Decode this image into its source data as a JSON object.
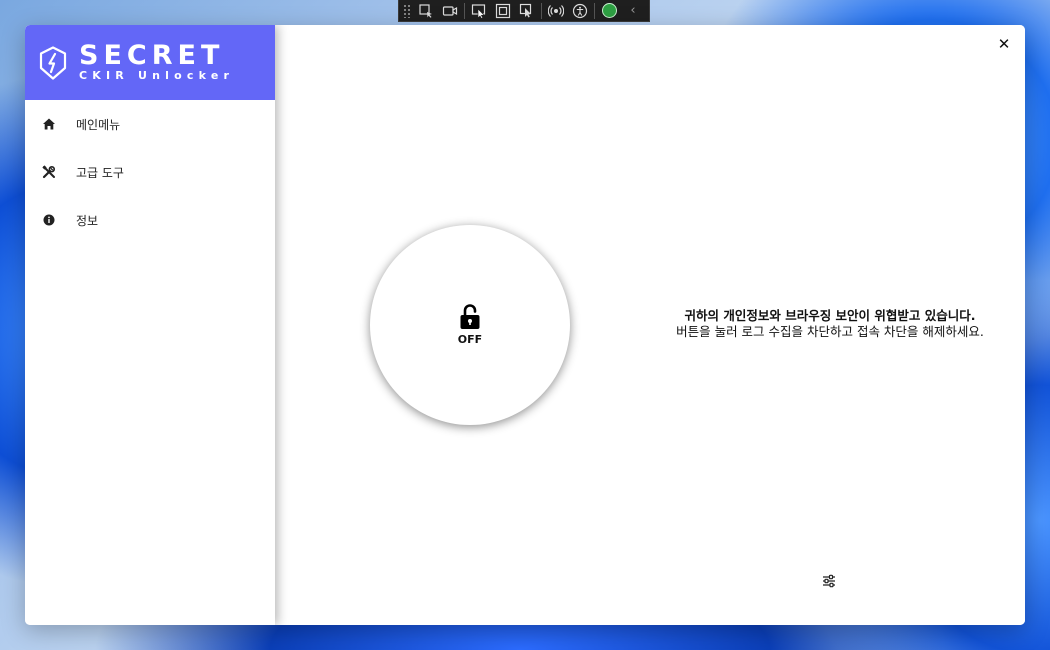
{
  "brand": {
    "title": "SECRET",
    "subtitle": "CKIR Unlocker",
    "color": "#6367f7"
  },
  "sidebar": {
    "items": [
      {
        "label": "메인메뉴",
        "icon": "home-icon"
      },
      {
        "label": "고급 도구",
        "icon": "tools-icon"
      },
      {
        "label": "정보",
        "icon": "info-icon"
      }
    ]
  },
  "main": {
    "toggle": {
      "state": "OFF",
      "icon": "unlock-icon"
    },
    "message": {
      "warning": "귀하의 개인정보와 브라우징 보안이 위협받고 있습니다.",
      "instruction": "버튼을 눌러 로그 수집을 차단하고 접속 차단을 해제하세요."
    },
    "close_label": "✕"
  },
  "devtool": {
    "icons": [
      "grip-icon",
      "select-element-icon",
      "video-icon",
      "pointer-icon",
      "frame-icon",
      "touch-select-icon",
      "broadcast-icon",
      "accessibility-icon",
      "check-icon",
      "chevron-left-icon"
    ]
  }
}
